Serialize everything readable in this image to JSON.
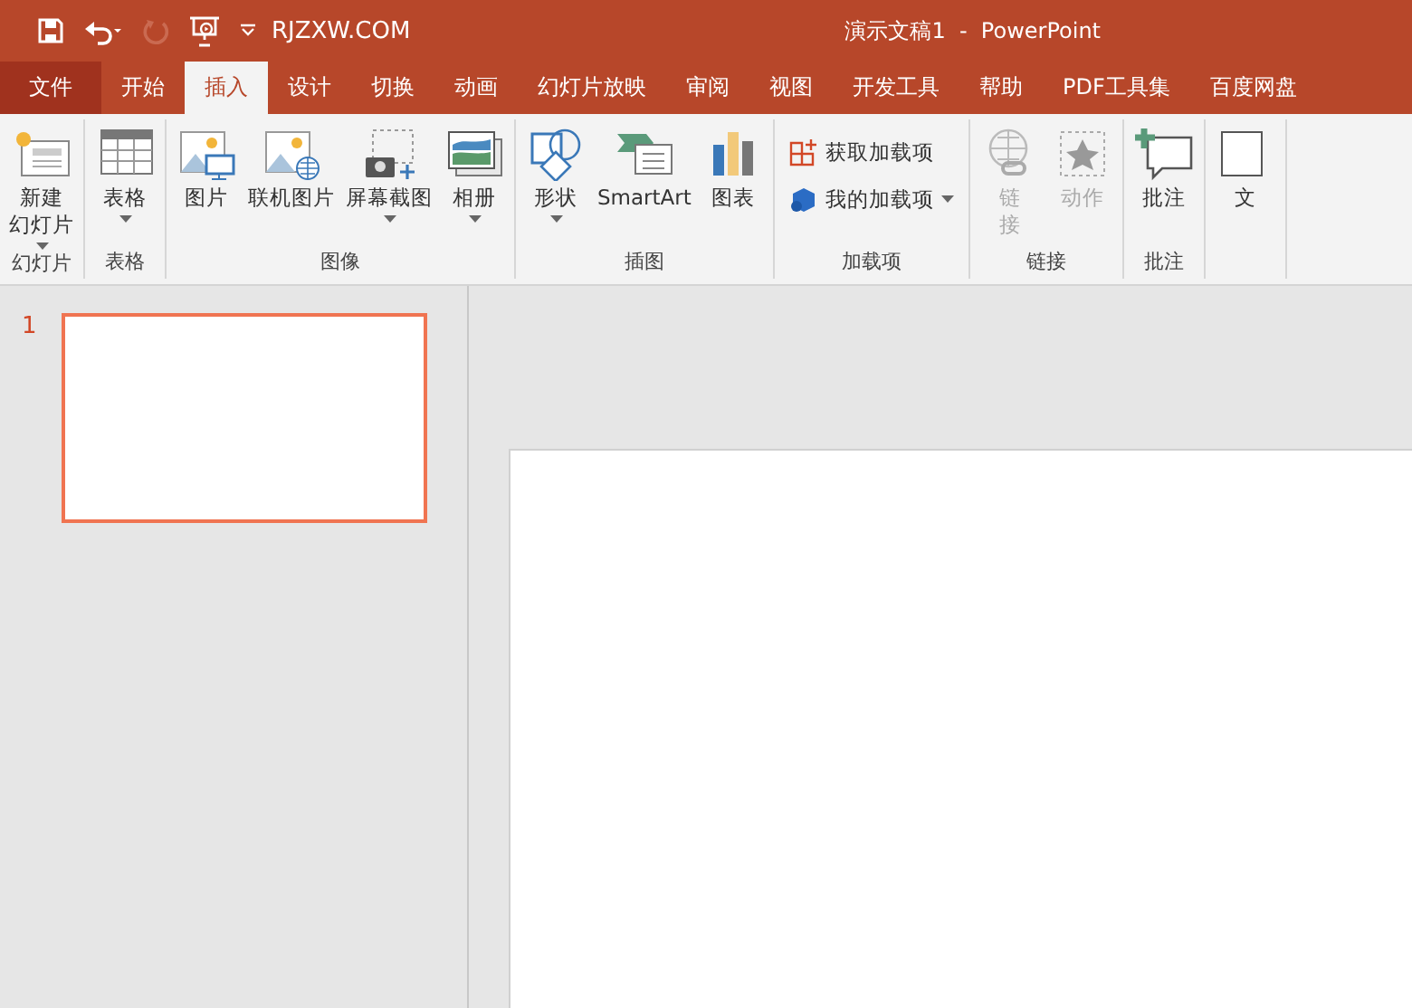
{
  "quick_access": {
    "site_label": "RJZXW.COM",
    "redo_disabled": true
  },
  "window": {
    "title": "演示文稿1  -  PowerPoint"
  },
  "tabs": [
    {
      "label": "文件",
      "kind": "file",
      "selected": false
    },
    {
      "label": "开始",
      "kind": "tab",
      "selected": false
    },
    {
      "label": "插入",
      "kind": "tab",
      "selected": true
    },
    {
      "label": "设计",
      "kind": "tab",
      "selected": false
    },
    {
      "label": "切换",
      "kind": "tab",
      "selected": false
    },
    {
      "label": "动画",
      "kind": "tab",
      "selected": false
    },
    {
      "label": "幻灯片放映",
      "kind": "tab",
      "selected": false
    },
    {
      "label": "审阅",
      "kind": "tab",
      "selected": false
    },
    {
      "label": "视图",
      "kind": "tab",
      "selected": false
    },
    {
      "label": "开发工具",
      "kind": "tab",
      "selected": false
    },
    {
      "label": "帮助",
      "kind": "tab",
      "selected": false
    },
    {
      "label": "PDF工具集",
      "kind": "tab",
      "selected": false
    },
    {
      "label": "百度网盘",
      "kind": "tab",
      "selected": false
    }
  ],
  "ribbon_groups": [
    {
      "label": "幻灯片",
      "commands": [
        {
          "lines": [
            "新建",
            "幻灯片"
          ],
          "kind": "large",
          "dropdown": true,
          "disabled": false
        }
      ]
    },
    {
      "label": "表格",
      "commands": [
        {
          "label": "表格",
          "kind": "large",
          "dropdown": true,
          "disabled": false
        }
      ]
    },
    {
      "label": "图像",
      "commands": [
        {
          "label": "图片",
          "kind": "large",
          "dropdown": false,
          "disabled": false
        },
        {
          "label": "联机图片",
          "kind": "large",
          "dropdown": false,
          "disabled": false
        },
        {
          "label": "屏幕截图",
          "kind": "large",
          "dropdown": true,
          "disabled": false
        },
        {
          "label": "相册",
          "kind": "large",
          "dropdown": true,
          "disabled": false
        }
      ]
    },
    {
      "label": "插图",
      "commands": [
        {
          "label": "形状",
          "kind": "large",
          "dropdown": true,
          "disabled": false
        },
        {
          "label": "SmartArt",
          "kind": "large",
          "dropdown": false,
          "disabled": false
        },
        {
          "label": "图表",
          "kind": "large",
          "dropdown": false,
          "disabled": false
        }
      ]
    },
    {
      "label": "加载项",
      "commands": [
        {
          "label": "获取加载项",
          "kind": "small",
          "dropdown": false,
          "disabled": false
        },
        {
          "label": "我的加载项",
          "kind": "small",
          "dropdown": true,
          "disabled": false
        }
      ]
    },
    {
      "label": "链接",
      "commands": [
        {
          "lines": [
            "链",
            "接"
          ],
          "kind": "large",
          "dropdown": false,
          "disabled": true
        },
        {
          "label": "动作",
          "kind": "large",
          "dropdown": false,
          "disabled": true
        }
      ]
    },
    {
      "label": "批注",
      "commands": [
        {
          "label": "批注",
          "kind": "large",
          "dropdown": false,
          "disabled": false
        }
      ]
    },
    {
      "commands": [
        {
          "label": "文",
          "kind": "large",
          "dropdown": false,
          "disabled": false
        }
      ]
    }
  ],
  "slides": [
    {
      "number": "1",
      "selected": true
    }
  ]
}
